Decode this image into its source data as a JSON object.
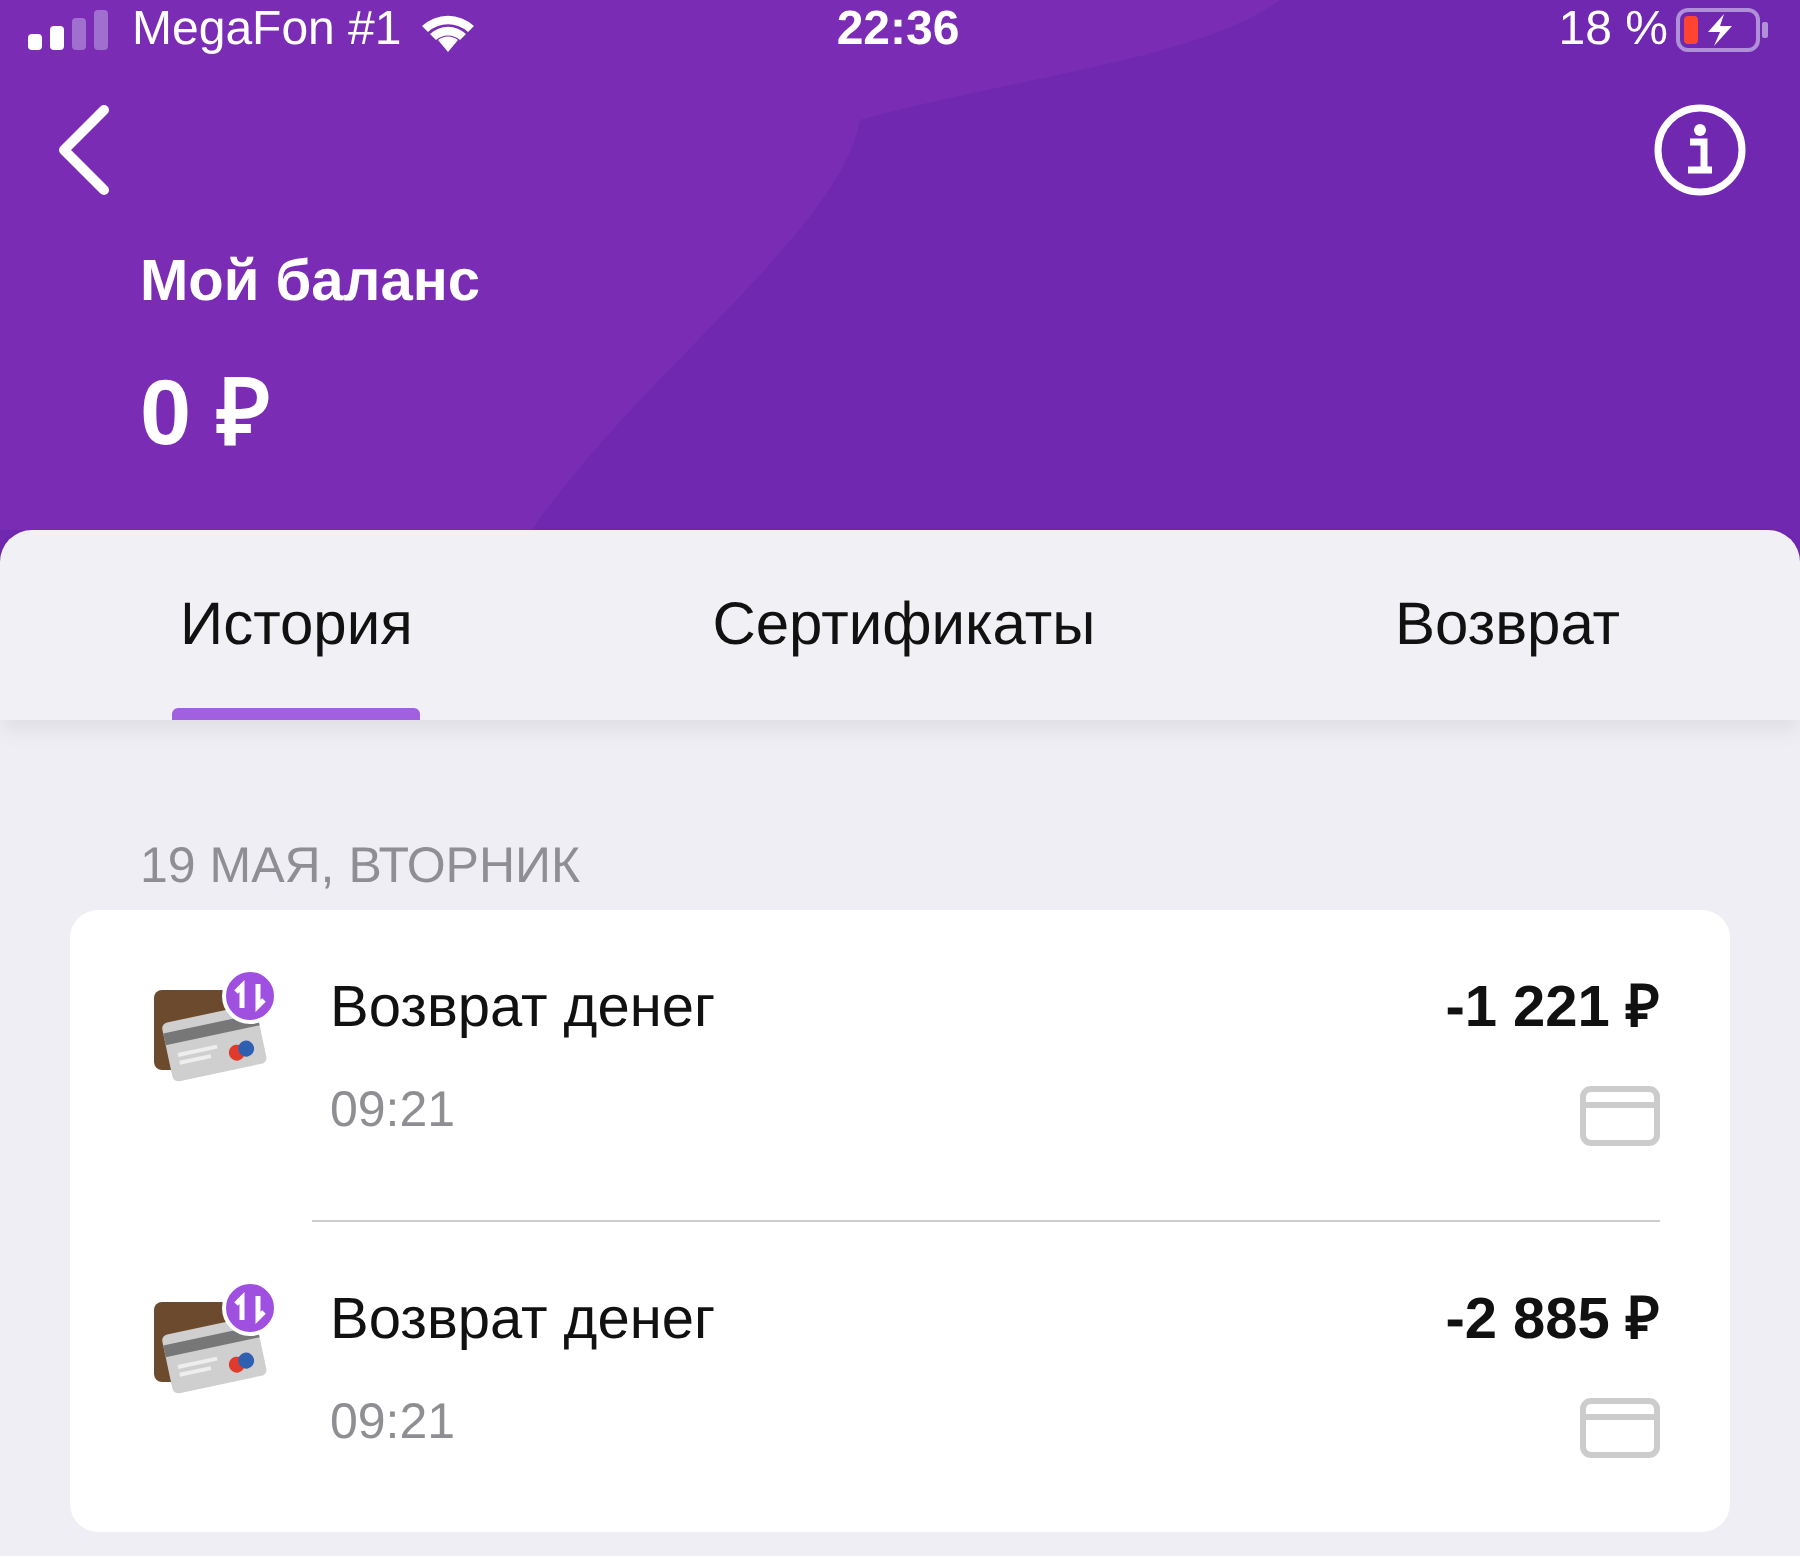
{
  "status_bar": {
    "carrier": "MegaFon #1",
    "time": "22:36",
    "battery": "18 %"
  },
  "header": {
    "title": "Мой баланс",
    "balance": "0 ₽"
  },
  "tabs": [
    {
      "label": "История",
      "selected": true
    },
    {
      "label": "Сертификаты",
      "selected": false
    },
    {
      "label": "Возврат",
      "selected": false
    }
  ],
  "date": "19 МАЯ, ВТОРНИК",
  "transactions": [
    {
      "title": "Возврат денег",
      "time": "09:21",
      "amount": "-1 221 ₽"
    },
    {
      "title": "Возврат денег",
      "time": "09:21",
      "amount": "-2 885 ₽"
    }
  ]
}
